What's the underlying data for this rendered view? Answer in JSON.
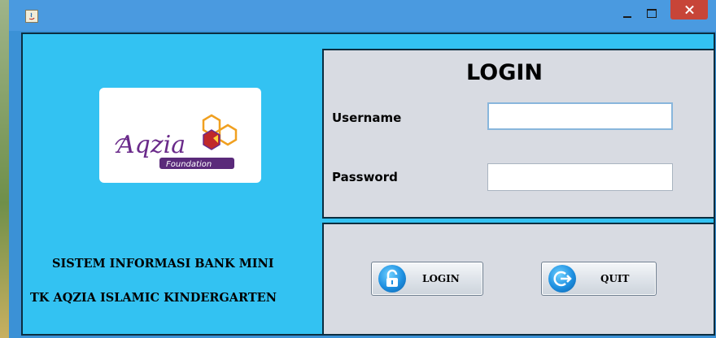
{
  "window": {
    "title": "",
    "controls": {
      "minimize": "minimize",
      "maximize": "maximize",
      "close": "close"
    }
  },
  "logo": {
    "brand": "Aqzia",
    "sub": "Foundation"
  },
  "captions": {
    "line1": "SISTEM INFORMASI BANK MINI",
    "line2": "TK AQZIA ISLAMIC KINDERGARTEN"
  },
  "login_form": {
    "title": "LOGIN",
    "username_label": "Username",
    "username_value": "",
    "password_label": "Password",
    "password_value": ""
  },
  "buttons": {
    "login_label": "LOGIN",
    "quit_label": "QUIT"
  },
  "icons": {
    "login": "padlock-icon",
    "quit": "exit-arrow-icon"
  },
  "colors": {
    "background": "#33c2f2",
    "panel": "#d8dbe2",
    "titlebar": "#4a9ae0",
    "close": "#c74538"
  }
}
